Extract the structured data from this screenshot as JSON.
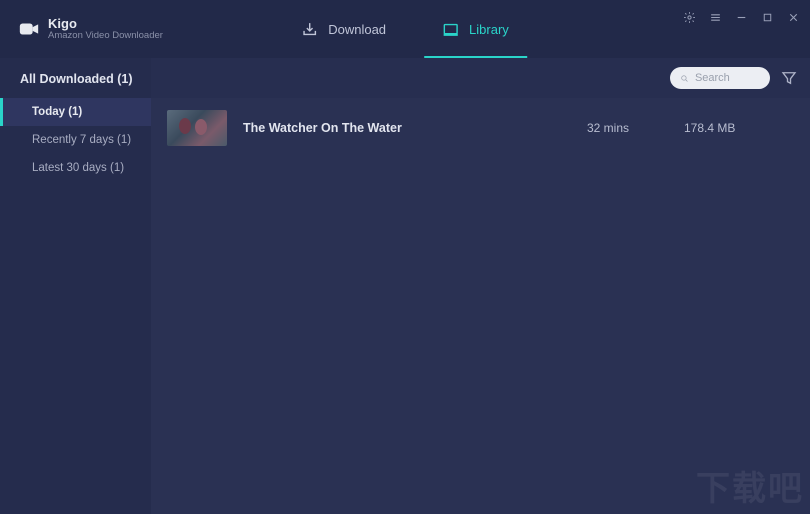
{
  "app": {
    "name": "Kigo",
    "subtitle": "Amazon Video Downloader"
  },
  "tabs": {
    "download": "Download",
    "library": "Library"
  },
  "sidebar": {
    "header": "All Downloaded (1)",
    "items": [
      {
        "label": "Today (1)"
      },
      {
        "label": "Recently 7 days (1)"
      },
      {
        "label": "Latest 30 days (1)"
      }
    ]
  },
  "search": {
    "placeholder": "Search"
  },
  "library": {
    "rows": [
      {
        "title": "The Watcher On The Water",
        "duration": "32 mins",
        "size": "178.4 MB"
      }
    ]
  },
  "watermark": "下载吧"
}
